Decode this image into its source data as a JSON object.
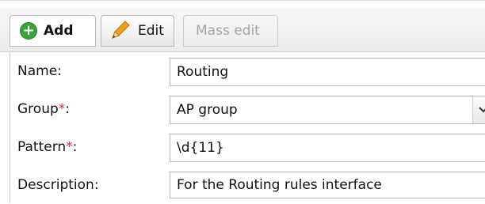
{
  "tabs": {
    "add_label": "Add",
    "edit_label": "Edit",
    "mass_edit_label": "Mass edit"
  },
  "form": {
    "name": {
      "label": "Name:",
      "value": "Routing"
    },
    "group": {
      "label": "Group",
      "required_mark": "*",
      "colon": ":",
      "value": "AP group"
    },
    "pattern": {
      "label": "Pattern",
      "required_mark": "*",
      "colon": ":",
      "value": "\\d{11}"
    },
    "description": {
      "label": "Description:",
      "value": "For the Routing rules interface"
    }
  },
  "colors": {
    "required": "#e03030",
    "add_icon": "#3aa33a",
    "pencil": "#f0a020"
  },
  "icons": {
    "add": "plus-circle-icon",
    "edit": "pencil-icon",
    "select": "chevron-down-icon"
  }
}
